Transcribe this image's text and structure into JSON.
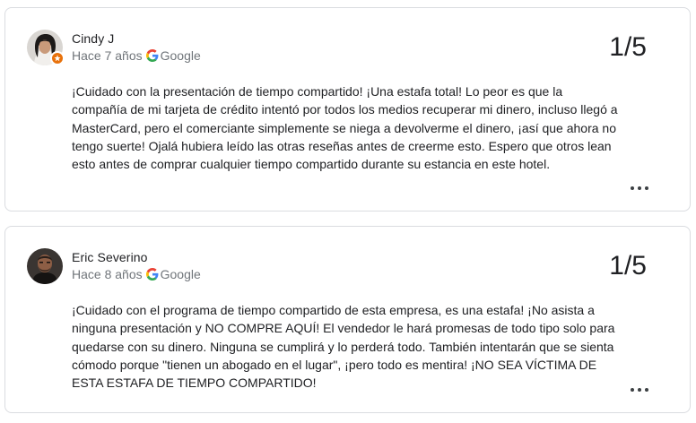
{
  "reviews": [
    {
      "author": "Cindy J",
      "time": "Hace 7 años",
      "source": "Google",
      "rating": "1/5",
      "text": "¡Cuidado con la presentación de tiempo compartido! ¡Una estafa total! Lo peor es que la compañía de mi tarjeta de crédito intentó por todos los medios recuperar mi dinero, incluso llegó a MasterCard, pero el comerciante simplemente se niega a devolverme el dinero, ¡así que ahora no tengo suerte! Ojalá hubiera leído las otras reseñas antes de creerme esto. Espero que otros lean esto antes de comprar cualquier tiempo compartido durante su estancia en este hotel.",
      "avatar_icon": "user-photo-avatar",
      "badge_icon": "local-guide-badge-icon",
      "badge_color": "#e8710a"
    },
    {
      "author": "Eric Severino",
      "time": "Hace 8 años",
      "source": "Google",
      "rating": "1/5",
      "text": "¡Cuidado con el programa de tiempo compartido de esta empresa, es una estafa! ¡No asista a ninguna presentación y NO COMPRE AQUÍ! El vendedor le hará promesas de todo tipo solo para quedarse con su dinero. Ninguna se cumplirá y lo perderá todo. También intentarán que se sienta cómodo porque \"tienen un abogado en el lugar\", ¡pero todo es mentira! ¡NO SEA VÍCTIMA DE ESTA ESTAFA DE TIEMPO COMPARTIDO!",
      "avatar_icon": "user-photo-avatar"
    }
  ],
  "colors": {
    "text": "#202124",
    "meta": "#70757a",
    "border": "#dadce0"
  },
  "icons": {
    "source": "google-g-icon",
    "menu": "more-options-icon"
  }
}
